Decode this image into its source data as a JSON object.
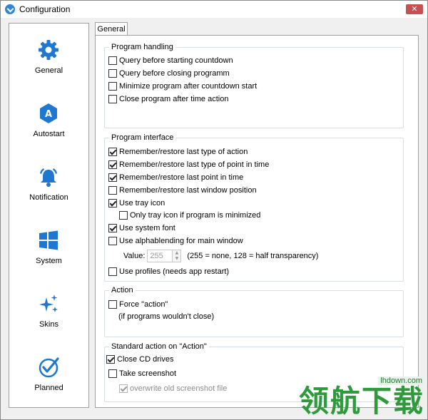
{
  "window": {
    "title": "Configuration",
    "close_glyph": "✕"
  },
  "sidebar": {
    "items": [
      {
        "label": "General",
        "icon": "gear-icon"
      },
      {
        "label": "Autostart",
        "icon": "autostart-icon"
      },
      {
        "label": "Notification",
        "icon": "bell-icon"
      },
      {
        "label": "System",
        "icon": "windows-icon"
      },
      {
        "label": "Skins",
        "icon": "sparkle-icon"
      },
      {
        "label": "Planned",
        "icon": "check-circle-icon"
      }
    ],
    "accent": "#1e78d2"
  },
  "tabs": [
    {
      "label": "General",
      "active": true
    }
  ],
  "groups": {
    "program_handling": {
      "title": "Program handling",
      "items": [
        {
          "label": "Query before starting countdown",
          "checked": false
        },
        {
          "label": "Query before closing programm",
          "checked": false
        },
        {
          "label": "Minimize program after  countdown start",
          "checked": false
        },
        {
          "label": "Close program after time action",
          "checked": false
        }
      ]
    },
    "program_interface": {
      "title": "Program interface",
      "items": [
        {
          "label": "Remember/restore last type of action",
          "checked": true
        },
        {
          "label": "Remember/restore last type of point in time",
          "checked": true
        },
        {
          "label": "Remember/restore last point in time",
          "checked": true
        },
        {
          "label": "Remember/restore last window position",
          "checked": false
        },
        {
          "label": "Use tray icon",
          "checked": true
        },
        {
          "label": "Only tray icon if program is minimized",
          "checked": false
        },
        {
          "label": "Use system font",
          "checked": true
        },
        {
          "label": "Use alphablending for main window",
          "checked": false
        },
        {
          "label": "Use profiles (needs app restart)",
          "checked": false
        }
      ],
      "value_label": "Value:",
      "value": "255",
      "value_hint": "(255 = none, 128 = half transparency)"
    },
    "action": {
      "title": "Action",
      "items": [
        {
          "label": "Force \"action\"",
          "checked": false
        }
      ],
      "note": "(if programs wouldn't close)"
    },
    "standard_action": {
      "title": "Standard action on \"Action\"",
      "items": [
        {
          "label": "Close CD drives",
          "checked": true
        },
        {
          "label": "Take screenshot",
          "checked": false
        },
        {
          "label": "overwrite old screenshot file",
          "checked": true,
          "disabled": true
        }
      ]
    }
  },
  "watermark": {
    "url": "lhdown.com",
    "text": "领航下载"
  }
}
